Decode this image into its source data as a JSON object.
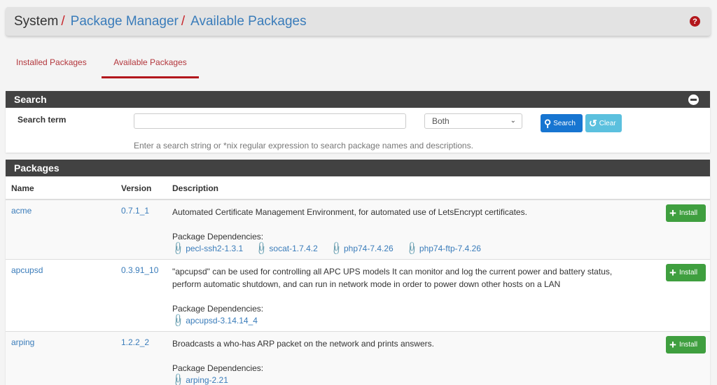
{
  "breadcrumb": {
    "items": [
      {
        "label": "System",
        "link": false
      },
      {
        "label": "Package Manager",
        "link": true
      },
      {
        "label": "Available Packages",
        "link": true
      }
    ],
    "separator": "/"
  },
  "header": {
    "help_icon": "question-circle-icon",
    "help_glyph": "?"
  },
  "tabs": [
    {
      "label": "Installed Packages",
      "active": false
    },
    {
      "label": "Available Packages",
      "active": true
    }
  ],
  "search": {
    "title": "Search",
    "collapse_icon": "minus-circle-icon",
    "term_label": "Search term",
    "term_value": "",
    "term_placeholder": "",
    "scope_selected": "Both",
    "search_button": "Search",
    "clear_button": "Clear",
    "help_text": "Enter a search string or *nix regular expression to search package names and descriptions."
  },
  "packages": {
    "title": "Packages",
    "columns": [
      "Name",
      "Version",
      "Description"
    ],
    "deps_label": "Package Dependencies:",
    "install_label": "Install",
    "rows": [
      {
        "name": "acme",
        "version": "0.7.1_1",
        "description": "Automated Certificate Management Environment, for automated use of LetsEncrypt certificates.",
        "dependencies": [
          "pecl-ssh2-1.3.1",
          "socat-1.7.4.2",
          "php74-7.4.26",
          "php74-ftp-7.4.26"
        ]
      },
      {
        "name": "apcupsd",
        "version": "0.3.91_10",
        "description": "\"apcupsd\" can be used for controlling all APC UPS models It can monitor and log the current power and battery status, perform automatic shutdown, and can run in network mode in order to power down other hosts on a LAN",
        "dependencies": [
          "apcupsd-3.14.14_4"
        ]
      },
      {
        "name": "arping",
        "version": "1.2.2_2",
        "description": "Broadcasts a who-has ARP packet on the network and prints answers.",
        "dependencies": [
          "arping-2.21"
        ]
      }
    ]
  },
  "colors": {
    "accent_red": "#b3171c",
    "link_blue": "#3a7cba",
    "panel_heading": "#424242",
    "search_button": "#1775d1",
    "clear_button": "#5bc0de",
    "install_button": "#3f9f3f"
  }
}
